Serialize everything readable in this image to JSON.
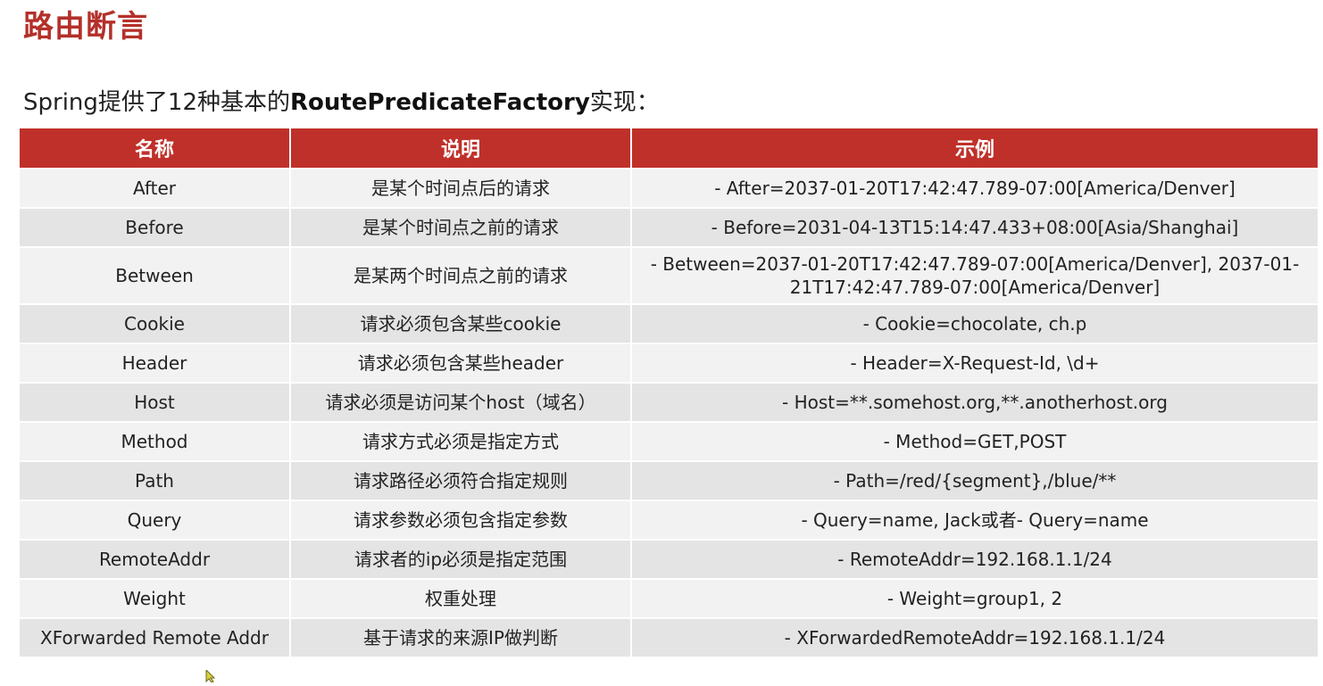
{
  "title": "路由断言",
  "intro": {
    "prefix": "Spring提供了12种基本的",
    "bold": "RoutePredicateFactory",
    "suffix": "实现："
  },
  "table": {
    "headers": [
      "名称",
      "说明",
      "示例"
    ],
    "rows": [
      {
        "name": "After",
        "desc": "是某个时间点后的请求",
        "example": "- After=2037-01-20T17:42:47.789-07:00[America/Denver]"
      },
      {
        "name": "Before",
        "desc": "是某个时间点之前的请求",
        "example": "- Before=2031-04-13T15:14:47.433+08:00[Asia/Shanghai]"
      },
      {
        "name": "Between",
        "desc": "是某两个时间点之前的请求",
        "example": "- Between=2037-01-20T17:42:47.789-07:00[America/Denver], 2037-01-21T17:42:47.789-07:00[America/Denver]"
      },
      {
        "name": "Cookie",
        "desc": "请求必须包含某些cookie",
        "example": "- Cookie=chocolate, ch.p"
      },
      {
        "name": "Header",
        "desc": "请求必须包含某些header",
        "example": "- Header=X-Request-Id, \\d+"
      },
      {
        "name": "Host",
        "desc": "请求必须是访问某个host（域名）",
        "example": "- Host=**.somehost.org,**.anotherhost.org"
      },
      {
        "name": "Method",
        "desc": "请求方式必须是指定方式",
        "example": "- Method=GET,POST"
      },
      {
        "name": "Path",
        "desc": "请求路径必须符合指定规则",
        "example": "- Path=/red/{segment},/blue/**"
      },
      {
        "name": "Query",
        "desc": "请求参数必须包含指定参数",
        "example": "- Query=name, Jack或者- Query=name"
      },
      {
        "name": "RemoteAddr",
        "desc": "请求者的ip必须是指定范围",
        "example": "- RemoteAddr=192.168.1.1/24"
      },
      {
        "name": "Weight",
        "desc": "权重处理",
        "example": "- Weight=group1, 2"
      },
      {
        "name": "XForwarded Remote Addr",
        "desc": "基于请求的来源IP做判断",
        "example": "- XForwardedRemoteAddr=192.168.1.1/24"
      }
    ]
  },
  "colors": {
    "accent": "#c0302a",
    "title": "#b4302a",
    "row_light": "#f2f2f2",
    "row_dark": "#e4e4e4"
  },
  "cursor_icon": "mouse-pointer-icon"
}
